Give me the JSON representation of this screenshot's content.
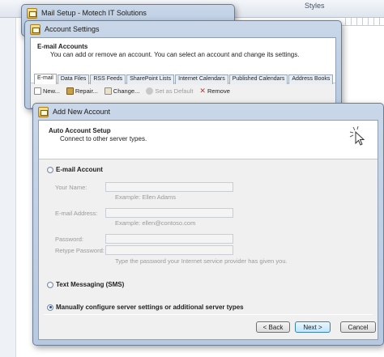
{
  "background": {
    "styles_label": "Styles"
  },
  "mail_setup": {
    "title": "Mail Setup - Motech IT Solutions"
  },
  "account_settings": {
    "title": "Account Settings",
    "header_title": "E-mail Accounts",
    "header_subtitle": "You can add or remove an account. You can select an account and change its settings.",
    "tabs": [
      {
        "label": "E-mail",
        "active": true
      },
      {
        "label": "Data Files"
      },
      {
        "label": "RSS Feeds"
      },
      {
        "label": "SharePoint Lists"
      },
      {
        "label": "Internet Calendars"
      },
      {
        "label": "Published Calendars"
      },
      {
        "label": "Address Books"
      }
    ],
    "toolbar": {
      "new": "New...",
      "repair": "Repair...",
      "change": "Change...",
      "set_default": "Set as Default",
      "remove": "Remove"
    }
  },
  "add_account": {
    "title": "Add New Account",
    "header_title": "Auto Account Setup",
    "header_subtitle": "Connect to other server types.",
    "email_account": {
      "label": "E-mail Account",
      "selected": false
    },
    "fields": {
      "name_label": "Your Name:",
      "name_value": "",
      "name_hint": "Example: Ellen Adams",
      "email_label": "E-mail Address:",
      "email_value": "",
      "email_hint": "Example: ellen@contoso.com",
      "password_label": "Password:",
      "password_value": "",
      "retype_label": "Retype Password:",
      "retype_value": "",
      "password_hint": "Type the password your Internet service provider has given you."
    },
    "text_messaging": {
      "label": "Text Messaging (SMS)",
      "selected": false
    },
    "manual_config": {
      "label": "Manually configure server settings or additional server types",
      "selected": true
    },
    "buttons": {
      "back": "< Back",
      "next": "Next >",
      "cancel": "Cancel"
    }
  },
  "colors": {
    "window_frame": "#b7c9e0",
    "default_button": "#bee6fd",
    "disabled_text": "#9a9a9a"
  }
}
